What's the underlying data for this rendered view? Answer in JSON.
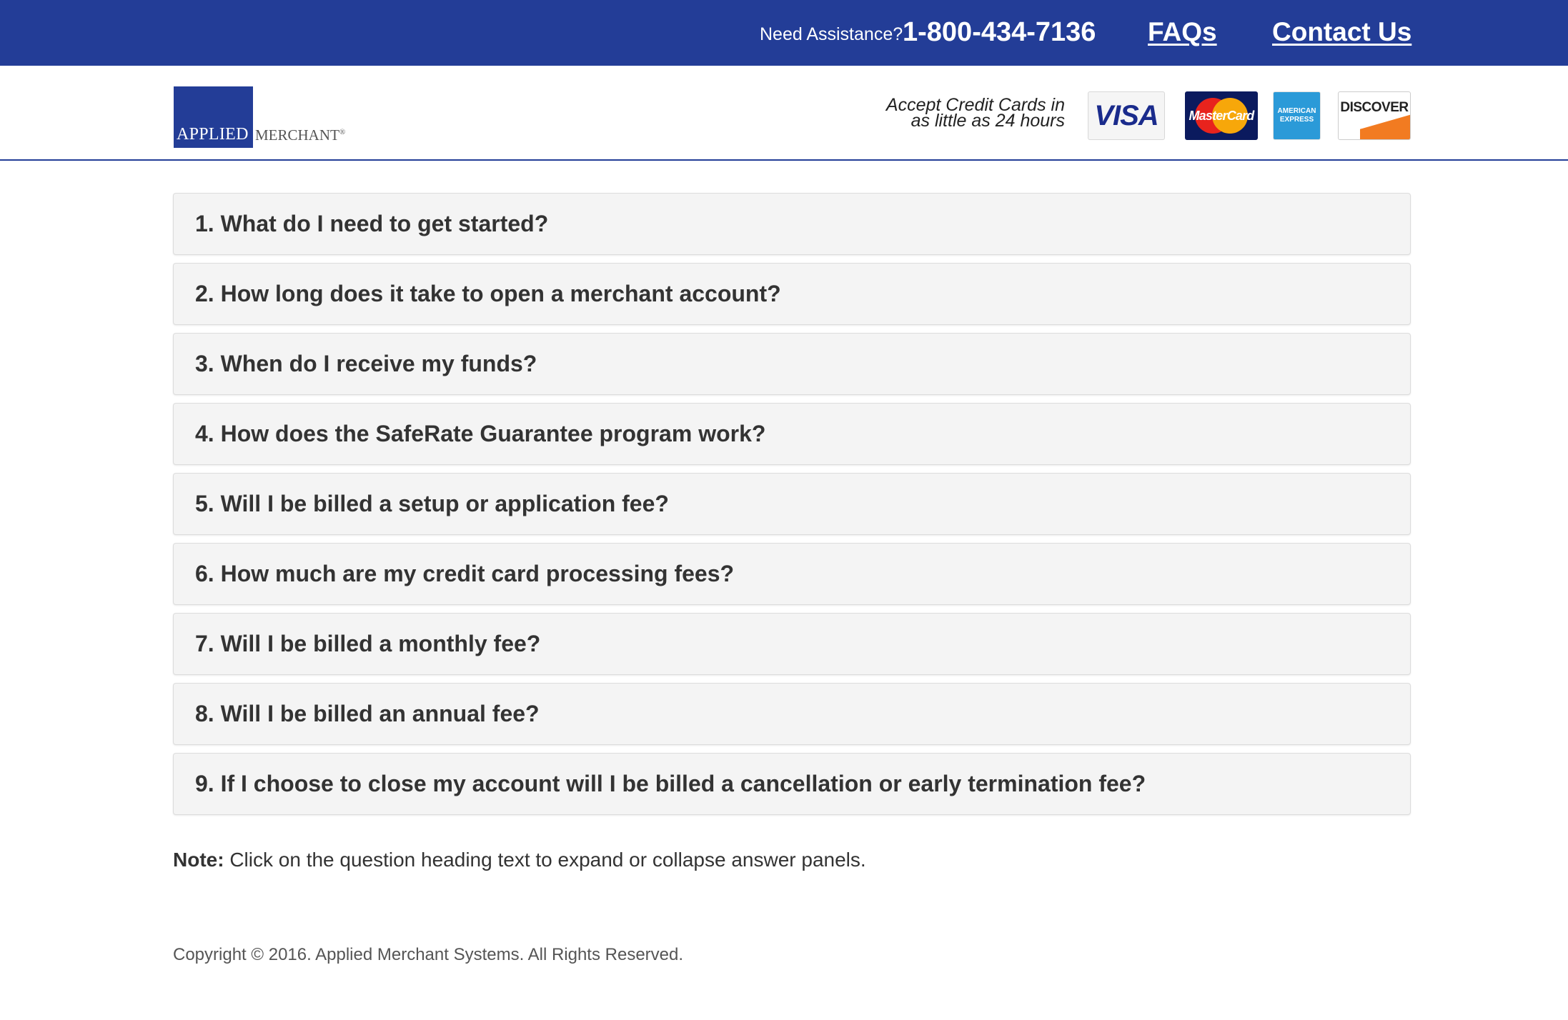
{
  "topbar": {
    "assist_label": "Need Assistance?",
    "phone": "1-800-434-7136",
    "faqs_link": "FAQs",
    "contact_link": "Contact Us",
    "background": "#233d97"
  },
  "header": {
    "logo_applied": "APPLIED",
    "logo_merchant": "MERCHANT",
    "logo_mark": "®",
    "accept_line1": "Accept Credit Cards in",
    "accept_line2": "as little as 24 hours",
    "cards": {
      "visa": "VISA",
      "mastercard": "MasterCard",
      "amex_line1": "AMERICAN",
      "amex_line2": "EXPRESS",
      "discover": "DISCOVER"
    }
  },
  "faq": {
    "items": [
      "1. What do I need to get started?",
      "2. How long does it take to open a merchant account?",
      "3. When do I receive my funds?",
      "4. How does the SafeRate Guarantee program work?",
      "5. Will I be billed a setup or application fee?",
      "6. How much are my credit card processing fees?",
      "7. Will I be billed a monthly fee?",
      "8. Will I be billed an annual fee?",
      "9. If I choose to close my account will I be billed a cancellation or early termination fee?"
    ]
  },
  "note": {
    "label": "Note:",
    "text": " Click on the question heading text to expand or collapse answer panels."
  },
  "footer": {
    "copyright": "Copyright © 2016. Applied Merchant Systems. All Rights Reserved."
  }
}
